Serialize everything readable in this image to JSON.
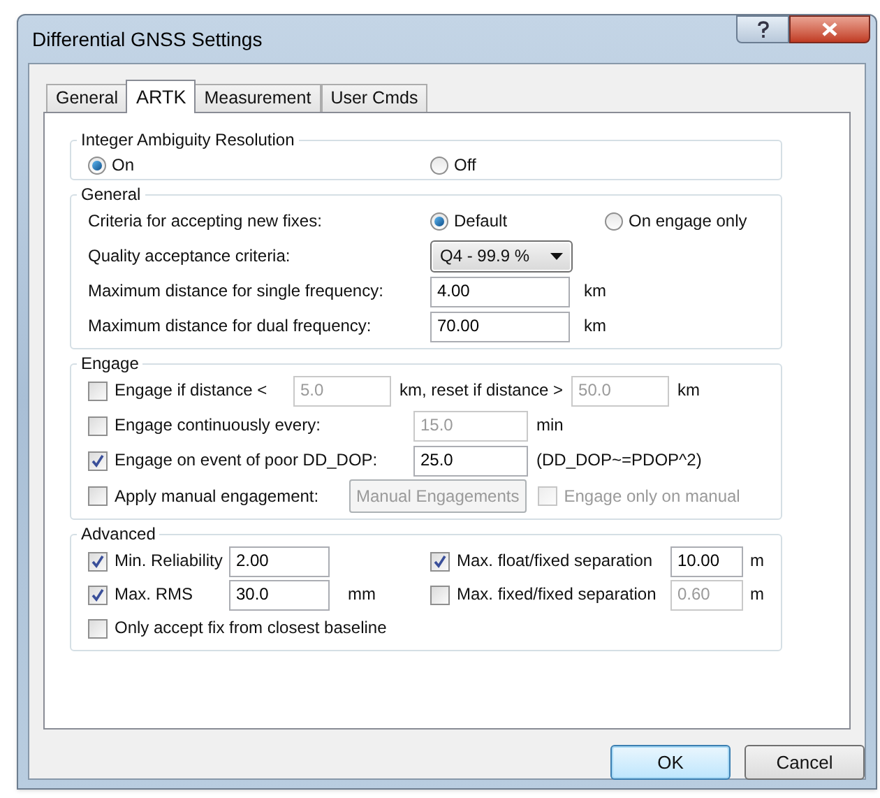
{
  "window": {
    "title": "Differential GNSS Settings"
  },
  "tabs": [
    {
      "label": "General",
      "selected": false
    },
    {
      "label": "ARTK",
      "selected": true
    },
    {
      "label": "Measurement",
      "selected": false
    },
    {
      "label": "User Cmds",
      "selected": false
    }
  ],
  "integer_ambiguity": {
    "title": "Integer Ambiguity Resolution",
    "options": [
      {
        "label": "On",
        "selected": true
      },
      {
        "label": "Off",
        "selected": false
      }
    ]
  },
  "general": {
    "title": "General",
    "rows": [
      {
        "kind": "radio",
        "label": "Criteria for accepting new fixes:",
        "options": [
          {
            "label": "Default",
            "selected": true
          },
          {
            "label": "On engage only",
            "selected": false
          }
        ]
      },
      {
        "kind": "dropdown",
        "label": "Quality acceptance criteria:",
        "value": "Q4 - 99.9 %"
      },
      {
        "kind": "field",
        "label": "Maximum distance for single frequency:",
        "value": "4.00",
        "unit": "km"
      },
      {
        "kind": "field",
        "label": "Maximum distance for dual frequency:",
        "value": "70.00",
        "unit": "km"
      }
    ]
  },
  "engage": {
    "title": "Engage",
    "rows": [
      {
        "label": "Engage if distance <",
        "checked": false,
        "parts": [
          {
            "kind": "field",
            "value": "5.0",
            "disabled": true
          },
          {
            "kind": "text",
            "text": "km, reset if distance >"
          },
          {
            "kind": "field",
            "value": "50.0",
            "disabled": true
          },
          {
            "kind": "text",
            "text": "km"
          }
        ]
      },
      {
        "label": "Engage continuously every:",
        "checked": false,
        "parts": [
          {
            "kind": "field",
            "value": "15.0",
            "disabled": true
          },
          {
            "kind": "text",
            "text": "min"
          }
        ]
      },
      {
        "label": "Engage on event of poor DD_DOP:",
        "checked": true,
        "parts": [
          {
            "kind": "field",
            "value": "25.0",
            "disabled": false
          },
          {
            "kind": "text",
            "text": "(DD_DOP~=PDOP^2)"
          }
        ]
      },
      {
        "label": "Apply manual engagement:",
        "checked": false,
        "parts": [
          {
            "kind": "button",
            "label": "Manual Engagements",
            "disabled": true
          },
          {
            "kind": "checkbox",
            "label": "Engage only on manual",
            "checked": false,
            "disabled": true
          }
        ]
      }
    ]
  },
  "advanced": {
    "title": "Advanced",
    "items": [
      {
        "kind": "checkbox_field",
        "label": "Min. Reliability",
        "checked": true,
        "value": "2.00",
        "disabled": false
      },
      {
        "kind": "checkbox_field",
        "label": "Max. float/fixed separation",
        "checked": true,
        "value": "10.00",
        "disabled": false,
        "unit": "m"
      },
      {
        "kind": "checkbox_field",
        "label": "Max. RMS",
        "checked": true,
        "value": "30.0",
        "disabled": false,
        "unit": "mm"
      },
      {
        "kind": "checkbox_field",
        "label": "Max. fixed/fixed separation",
        "checked": false,
        "value": "0.60",
        "disabled": true,
        "unit": "m"
      },
      {
        "kind": "checkbox",
        "label": "Only accept fix from closest baseline",
        "checked": false
      }
    ]
  },
  "buttons": [
    {
      "label": "OK",
      "default": true
    },
    {
      "label": "Cancel",
      "default": false
    }
  ]
}
